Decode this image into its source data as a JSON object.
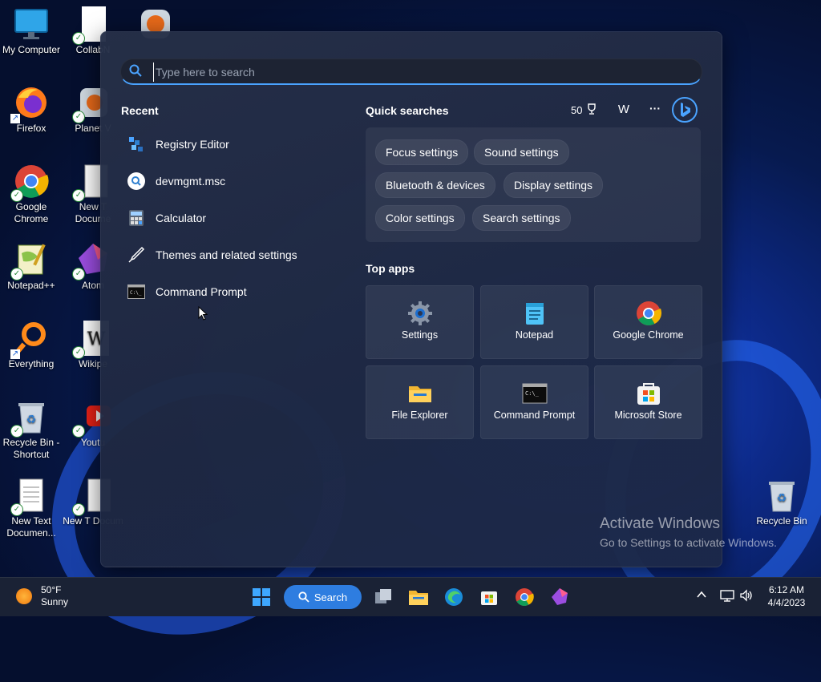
{
  "desktop": {
    "icons": [
      {
        "label": "My Computer",
        "icon": "monitor-icon"
      },
      {
        "label": "CollabN",
        "icon": "document-icon"
      },
      {
        "label": "Firefox",
        "icon": "firefox-icon"
      },
      {
        "label": "Planet V",
        "icon": "planet-icon"
      },
      {
        "label": "Google Chrome",
        "icon": "chrome-icon"
      },
      {
        "label": "New T Docume",
        "icon": "document-icon"
      },
      {
        "label": "Notepad++",
        "icon": "notepadpp-icon"
      },
      {
        "label": "Atom",
        "icon": "atom-icon"
      },
      {
        "label": "Everything",
        "icon": "search-icon"
      },
      {
        "label": "Wikipe",
        "icon": "wikipedia-icon"
      },
      {
        "label": "Recycle Bin - Shortcut",
        "icon": "recycle-bin-icon"
      },
      {
        "label": "Youtu",
        "icon": "youtube-icon"
      },
      {
        "label": "New Text Documen...",
        "icon": "document-icon"
      },
      {
        "label": "New T Docum",
        "icon": "document-icon"
      },
      {
        "label": "Recycle Bin",
        "icon": "recycle-bin-icon"
      }
    ]
  },
  "search": {
    "placeholder": "Type here to search"
  },
  "recent": {
    "title": "Recent",
    "items": [
      {
        "label": "Registry Editor",
        "icon": "registry-icon"
      },
      {
        "label": "devmgmt.msc",
        "icon": "search-icon"
      },
      {
        "label": "Calculator",
        "icon": "calculator-icon"
      },
      {
        "label": "Themes and related settings",
        "icon": "brush-icon"
      },
      {
        "label": "Command Prompt",
        "icon": "terminal-icon"
      }
    ]
  },
  "quick_searches": {
    "title": "Quick searches",
    "points": "50",
    "user_initial": "W",
    "more": "···",
    "pills": [
      "Focus settings",
      "Sound settings",
      "Bluetooth & devices",
      "Display settings",
      "Color settings",
      "Search settings"
    ]
  },
  "top_apps": {
    "title": "Top apps",
    "apps": [
      {
        "label": "Settings",
        "icon": "gear-icon"
      },
      {
        "label": "Notepad",
        "icon": "notepad-icon"
      },
      {
        "label": "Google Chrome",
        "icon": "chrome-icon"
      },
      {
        "label": "File Explorer",
        "icon": "folder-icon"
      },
      {
        "label": "Command Prompt",
        "icon": "terminal-icon"
      },
      {
        "label": "Microsoft Store",
        "icon": "store-icon"
      }
    ]
  },
  "watermark": {
    "line1": "Activate Windows",
    "line2": "Go to Settings to activate Windows."
  },
  "taskbar": {
    "weather_temp": "50°F",
    "weather_desc": "Sunny",
    "search_label": "Search",
    "time": "6:12 AM",
    "date": "4/4/2023"
  },
  "colors": {
    "accent": "#2e7de0",
    "panel": "#262f48",
    "taskbar": "#1a2235"
  }
}
